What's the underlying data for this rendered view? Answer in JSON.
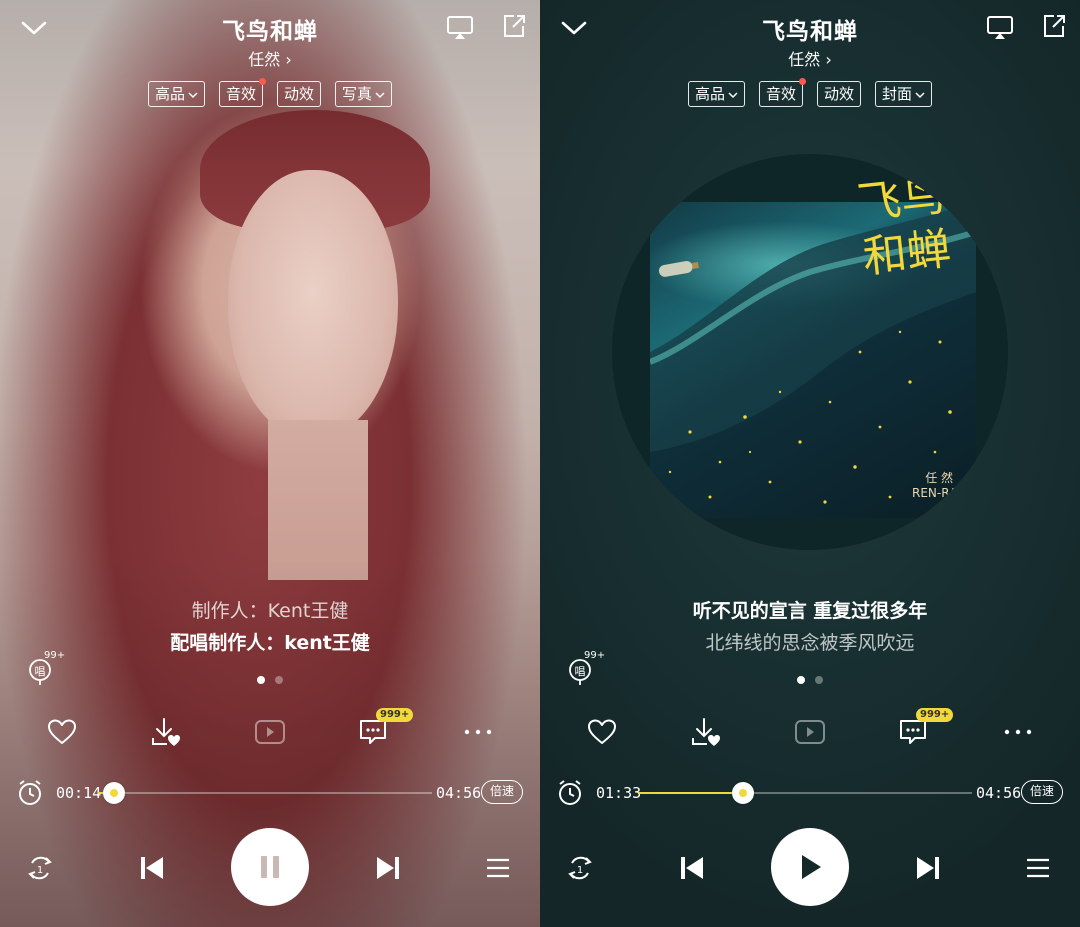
{
  "screens": [
    {
      "id": "left",
      "header": {
        "title": "飞鸟和蝉",
        "artist": "任然 ›"
      },
      "tags": [
        {
          "label": "高品",
          "dropdown": true,
          "dot": false
        },
        {
          "label": "音效",
          "dropdown": false,
          "dot": true
        },
        {
          "label": "动效",
          "dropdown": false,
          "dot": false
        },
        {
          "label": "写真",
          "dropdown": true,
          "dot": false
        }
      ],
      "lines": {
        "first": "制作人：Kent王健",
        "second": "配唱制作人：kent王健"
      },
      "mic_badge": "99+",
      "comment_badge": "999+",
      "progress": {
        "elapsed": "00:14",
        "total": "04:56",
        "fraction": 0.047,
        "speed_label": "倍速"
      },
      "state": "playing"
    },
    {
      "id": "right",
      "header": {
        "title": "飞鸟和蝉",
        "artist": "任然 ›"
      },
      "tags": [
        {
          "label": "高品",
          "dropdown": true,
          "dot": false
        },
        {
          "label": "音效",
          "dropdown": false,
          "dot": true
        },
        {
          "label": "动效",
          "dropdown": false,
          "dot": false
        },
        {
          "label": "封面",
          "dropdown": true,
          "dot": false
        }
      ],
      "album_art": {
        "title_text": "飞鸟和蝉",
        "artist_text": "任 然\nREN-RAN"
      },
      "lines": {
        "first": "听不见的宣言 重复过很多年",
        "second": "北纬线的思念被季风吹远"
      },
      "mic_badge": "99+",
      "comment_badge": "999+",
      "progress": {
        "elapsed": "01:33",
        "total": "04:56",
        "fraction": 0.314,
        "speed_label": "倍速"
      },
      "state": "paused"
    }
  ],
  "colors": {
    "accent": "#f2d83a",
    "dot": "#ff5a4e",
    "dark_bg": "#182f31"
  }
}
